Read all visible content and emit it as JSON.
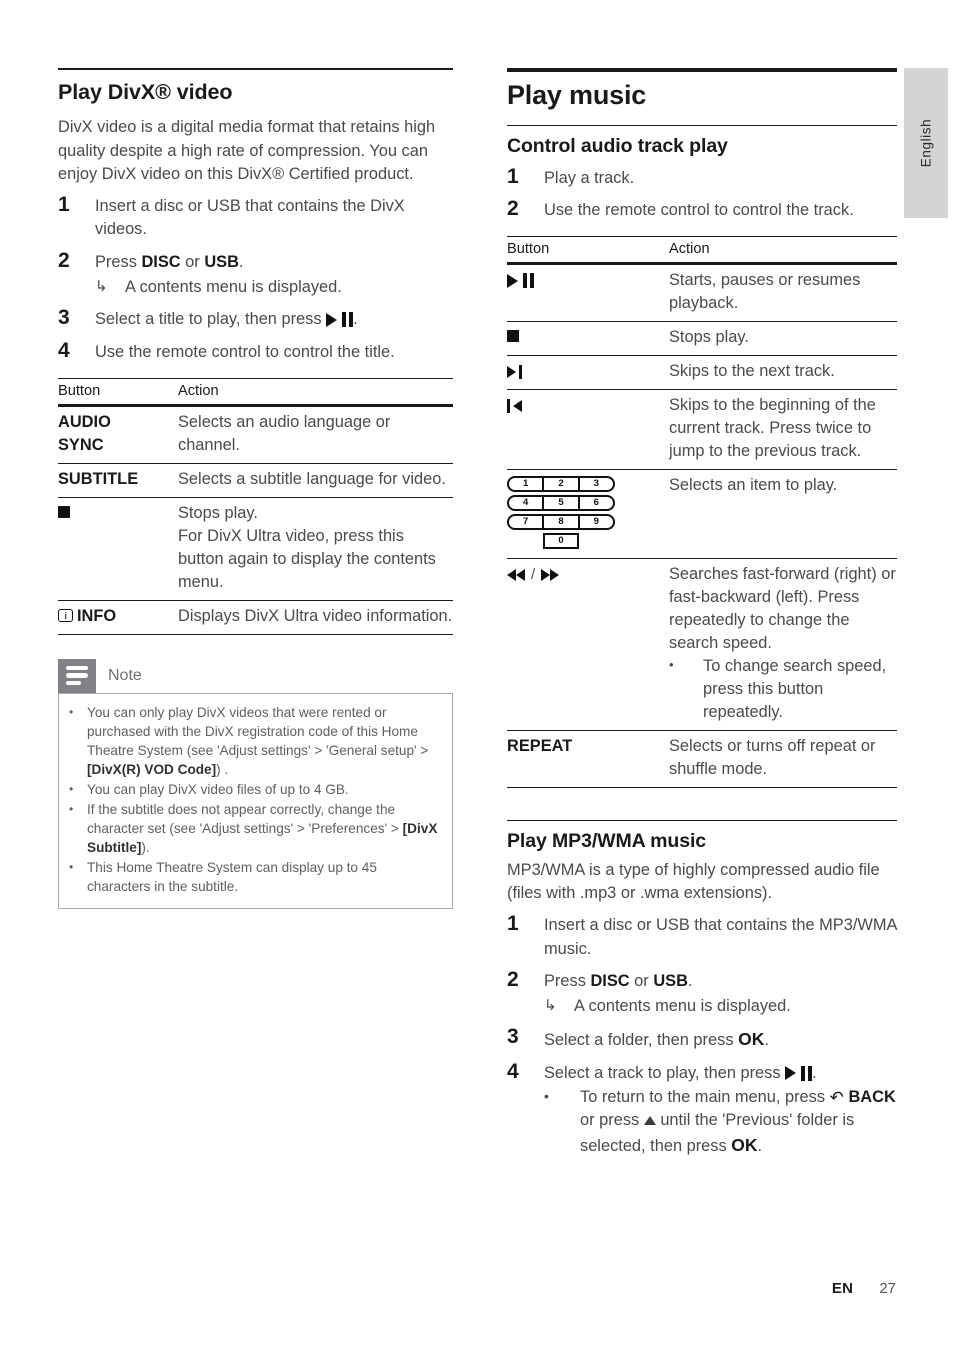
{
  "page": {
    "language_tab": "English",
    "footer": {
      "locale": "EN",
      "page_number": "27"
    }
  },
  "left_column": {
    "heading": "Play DivX® video",
    "intro": "DivX video is a digital media format that retains high quality despite a high rate of compression. You can enjoy DivX video on this DivX® Certified product.",
    "steps": [
      {
        "num": "1",
        "text": "Insert a disc or USB that contains the DivX videos."
      },
      {
        "num": "2",
        "text_parts": {
          "pre": "Press ",
          "b1": "DISC",
          "mid": " or ",
          "b2": "USB",
          "post": "."
        },
        "sub_arrow": "A contents menu is displayed."
      },
      {
        "num": "3",
        "pre": "Select a title to play, then press ",
        "post": "."
      },
      {
        "num": "4",
        "text": "Use the remote control to control the title."
      }
    ],
    "table": {
      "headers": {
        "button": "Button",
        "action": "Action"
      },
      "rows": [
        {
          "button": "AUDIO SYNC",
          "action": "Selects an audio language or channel."
        },
        {
          "button": "SUBTITLE",
          "action": "Selects a subtitle language for video."
        },
        {
          "button_icon": "stop-icon",
          "action": "Stops play.\nFor DivX Ultra video, press this button again to display the contents menu."
        },
        {
          "button_icon": "info-icon",
          "button": "INFO",
          "action": "Displays DivX Ultra video information."
        }
      ]
    },
    "note": {
      "title": "Note",
      "items": [
        {
          "pre": "You can only play DivX videos that were rented or purchased with the DivX registration code of this Home Theatre System (see 'Adjust settings' > 'General setup' > ",
          "bold": "[DivX(R) VOD Code]",
          "post": ") ."
        },
        {
          "pre": "You can play DivX video files of up to 4 GB.",
          "bold": "",
          "post": ""
        },
        {
          "pre": "If the subtitle does not appear correctly, change the character set (see 'Adjust settings' > 'Preferences' > ",
          "bold": "[DivX Subtitle]",
          "post": ")."
        },
        {
          "pre": "This Home Theatre System can display up to 45 characters in the subtitle.",
          "bold": "",
          "post": ""
        }
      ]
    }
  },
  "right_column": {
    "chapter_heading": "Play music",
    "section1": {
      "heading": "Control audio track play",
      "steps": [
        {
          "num": "1",
          "text": "Play a track."
        },
        {
          "num": "2",
          "text": "Use the remote control to control the track."
        }
      ],
      "table": {
        "headers": {
          "button": "Button",
          "action": "Action"
        },
        "rows": [
          {
            "button_icon": "play-pause-icon",
            "action": "Starts, pauses or resumes playback."
          },
          {
            "button_icon": "stop-icon",
            "action": "Stops play."
          },
          {
            "button_icon": "next-track-icon",
            "action": "Skips to the next track."
          },
          {
            "button_icon": "previous-track-icon",
            "action": "Skips to the beginning of the current track. Press twice to jump to the previous track."
          },
          {
            "button_icon": "numeric-keypad-icon",
            "action": "Selects an item to play."
          },
          {
            "button_icon": "rewind-forward-icon",
            "action": "Searches fast-forward (right) or fast-backward (left). Press repeatedly to change the search speed.",
            "bullet": "To change search speed, press this button repeatedly."
          },
          {
            "button": "REPEAT",
            "action": "Selects or turns off repeat or shuffle mode."
          }
        ]
      },
      "keypad": {
        "row1": [
          "1",
          "2",
          "3"
        ],
        "row2": [
          "4",
          "5",
          "6"
        ],
        "row3": [
          "7",
          "8",
          "9"
        ],
        "row4": [
          "0"
        ]
      }
    },
    "section2": {
      "heading": "Play MP3/WMA music",
      "intro": "MP3/WMA is a type of highly compressed audio file (files with .mp3 or .wma extensions).",
      "steps": [
        {
          "num": "1",
          "text": "Insert a disc or USB that contains the MP3/WMA music."
        },
        {
          "num": "2",
          "pre": "Press ",
          "b1": "DISC",
          "mid": " or ",
          "b2": "USB",
          "post": ".",
          "sub_arrow": "A contents menu is displayed."
        },
        {
          "num": "3",
          "pre": "Select a folder, then press ",
          "bold": "OK",
          "post": "."
        },
        {
          "num": "4",
          "pre": "Select a track to play, then press ",
          "post": ".",
          "bullet": {
            "p1": "To return to the main menu, press ",
            "b1": "BACK",
            "p2": " or press ",
            "p3": " until the 'Previous' folder is selected, then press ",
            "b2": "OK",
            "p4": "."
          }
        }
      ]
    }
  }
}
